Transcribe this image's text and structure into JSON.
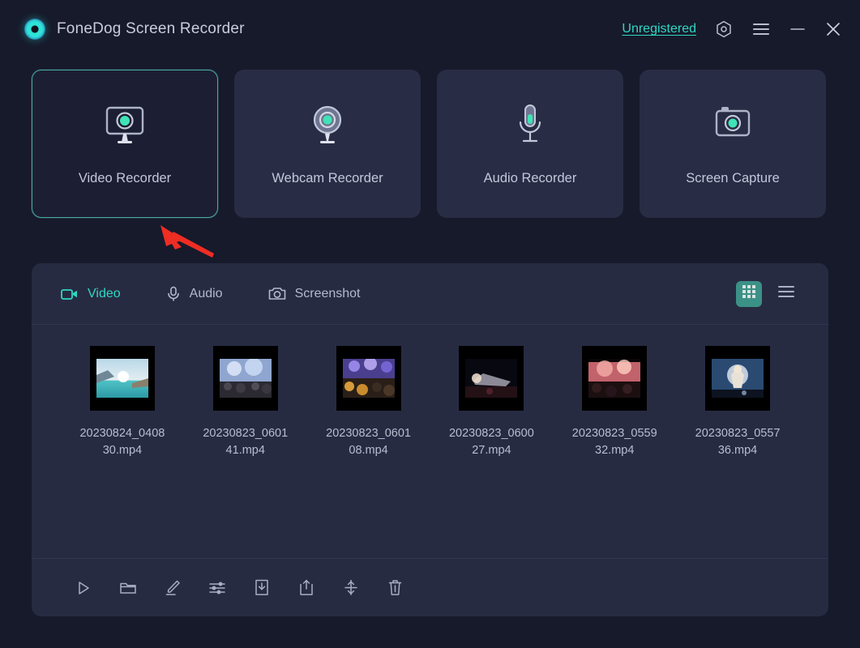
{
  "titlebar": {
    "app_title": "FoneDog Screen Recorder",
    "logo_icon": "fonedog-logo-icon",
    "license_label": "Unregistered",
    "license_color": "#2fd8c3",
    "settings_icon": "hexagon-settings-icon",
    "menu_icon": "hamburger-menu-icon",
    "minimize_icon": "minimize-icon",
    "close_icon": "close-icon"
  },
  "modes": {
    "cards": [
      {
        "label": "Video Recorder",
        "icon": "monitor-record-icon",
        "selected": true
      },
      {
        "label": "Webcam Recorder",
        "icon": "webcam-record-icon",
        "selected": false
      },
      {
        "label": "Audio Recorder",
        "icon": "microphone-record-icon",
        "selected": false
      },
      {
        "label": "Screen Capture",
        "icon": "camera-capture-icon",
        "selected": false
      }
    ]
  },
  "annotation": {
    "arrow_color": "#ee2d23",
    "arrow_target": "Video Recorder"
  },
  "library": {
    "tabs": [
      {
        "label": "Video",
        "icon": "video-camera-icon",
        "active": true
      },
      {
        "label": "Audio",
        "icon": "microphone-icon",
        "active": false
      },
      {
        "label": "Screenshot",
        "icon": "camera-icon",
        "active": false
      }
    ],
    "view_modes": [
      {
        "name": "grid-view",
        "icon": "grid-view-icon",
        "active": true
      },
      {
        "name": "list-view",
        "icon": "list-view-icon",
        "active": false
      }
    ],
    "accent_color": "#2fd8c3",
    "active_view_bg": "#3c9187",
    "files": [
      {
        "name": "20230824_040830.mp4",
        "thumb": "beach-sunset"
      },
      {
        "name": "20230823_060141.mp4",
        "thumb": "concert-crowd-blue"
      },
      {
        "name": "20230823_060108.mp4",
        "thumb": "concert-crowd-purple"
      },
      {
        "name": "20230823_060027.mp4",
        "thumb": "stage-dark"
      },
      {
        "name": "20230823_055932.mp4",
        "thumb": "concert-crowd-red"
      },
      {
        "name": "20230823_055736.mp4",
        "thumb": "singer-stage"
      }
    ],
    "toolbar": [
      {
        "name": "play-button",
        "icon": "play-icon"
      },
      {
        "name": "folder-button",
        "icon": "folder-icon"
      },
      {
        "name": "edit-button",
        "icon": "pen-edit-icon"
      },
      {
        "name": "settings-button",
        "icon": "sliders-icon"
      },
      {
        "name": "download-button",
        "icon": "download-icon"
      },
      {
        "name": "share-button",
        "icon": "share-upload-icon"
      },
      {
        "name": "trim-button",
        "icon": "trim-cut-icon"
      },
      {
        "name": "delete-button",
        "icon": "trash-icon"
      }
    ]
  }
}
